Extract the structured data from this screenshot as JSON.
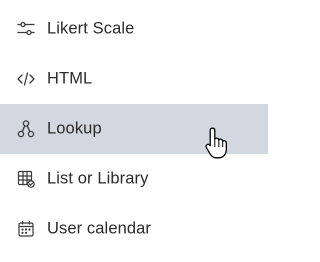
{
  "menu": {
    "items": [
      {
        "label": "Likert Scale",
        "icon": "sliders-icon",
        "hovered": false
      },
      {
        "label": "HTML",
        "icon": "code-icon",
        "hovered": false
      },
      {
        "label": "Lookup",
        "icon": "lookup-icon",
        "hovered": true
      },
      {
        "label": "List or Library",
        "icon": "table-icon",
        "hovered": false
      },
      {
        "label": "User calendar",
        "icon": "calendar-icon",
        "hovered": false
      }
    ]
  },
  "colors": {
    "hover_background": "#d3d8e0",
    "text": "#2b2b2b",
    "icon": "#3a3a3a"
  },
  "cursor": {
    "icon": "hand-pointer-icon"
  }
}
